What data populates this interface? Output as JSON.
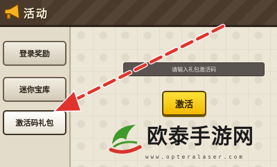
{
  "header": {
    "title": "活动",
    "icon": "horn-icon"
  },
  "sidebar": {
    "items": [
      {
        "label": "登录奖励",
        "active": false
      },
      {
        "label": "迷你宝库",
        "active": false
      },
      {
        "label": "激活码礼包",
        "active": true
      }
    ]
  },
  "redeem": {
    "placeholder": "请输入礼包激活码",
    "button_label": "激活"
  },
  "watermark": {
    "name": "欧泰手游网",
    "url": "www.opteralaser.com"
  },
  "colors": {
    "header_bg": "#4a3a2c",
    "accent_button": "#f2c400",
    "arrow": "#e0332e",
    "logo_green": "#3e9a2a",
    "logo_red": "#d9332b"
  }
}
